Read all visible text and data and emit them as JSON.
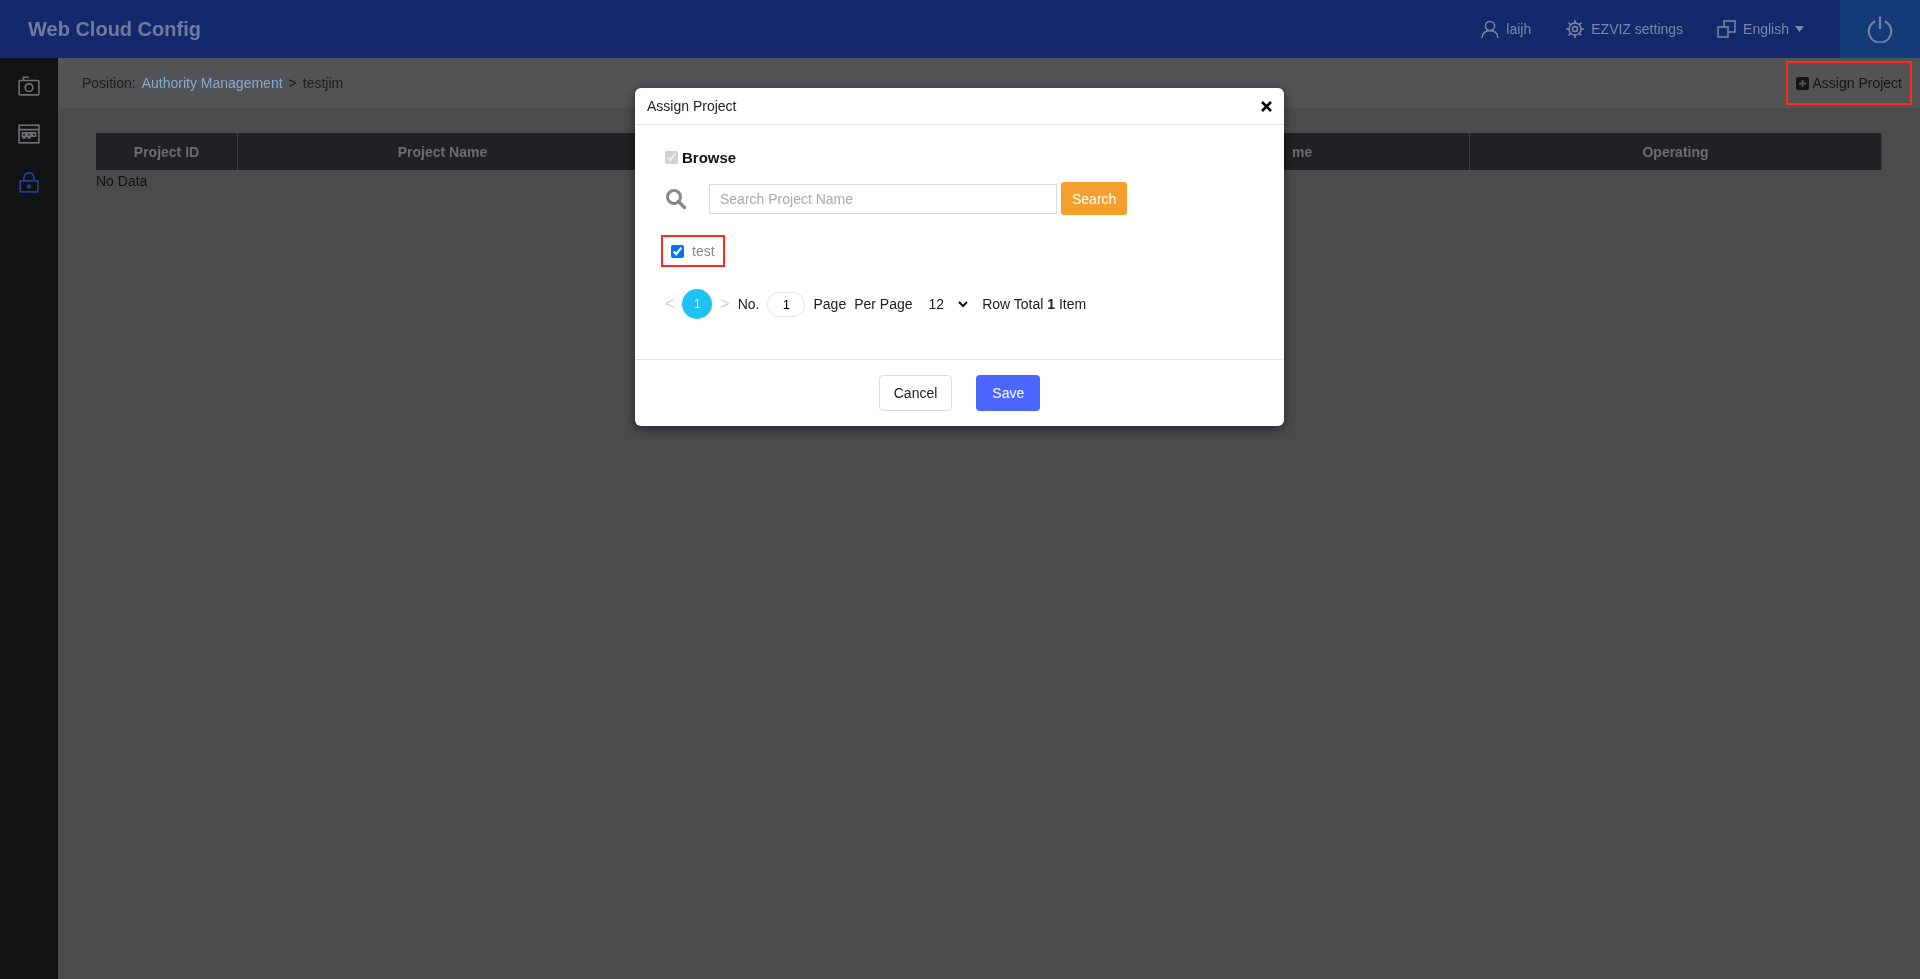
{
  "header": {
    "title": "Web Cloud Config",
    "user": "laijh",
    "settings": "EZVIZ settings",
    "language": "English"
  },
  "sidebar": {
    "items": [
      {
        "kind": "camera",
        "selected": false
      },
      {
        "kind": "calendar",
        "selected": false
      },
      {
        "kind": "lock",
        "selected": true
      }
    ]
  },
  "breadcrumb": {
    "prefix": "Position:",
    "link": "Authority Management",
    "separator": ">",
    "current": "testjim"
  },
  "assign_button": {
    "label": "Assign Project",
    "highlighted": true
  },
  "table": {
    "columns": [
      "Project ID",
      "Project Name",
      "me",
      "Operating"
    ],
    "empty_text": "No Data"
  },
  "dialog": {
    "title": "Assign Project",
    "browse": {
      "label": "Browse",
      "checked": true,
      "disabled": true
    },
    "search": {
      "placeholder": "Search Project Name",
      "button": "Search"
    },
    "projects": [
      {
        "name": "test",
        "checked": true,
        "highlighted": true
      }
    ],
    "pagination": {
      "prev": "<",
      "pages": [
        {
          "label": "1",
          "selected": true
        }
      ],
      "next": ">",
      "no_label": "No.",
      "page_value": "1",
      "page_label": "Page",
      "per_page_label": "Per Page",
      "per_page": "12",
      "total_text": "Row Total **1** Item"
    },
    "buttons": [
      {
        "label": "Cancel",
        "kind": "default"
      },
      {
        "label": "Save",
        "kind": "primary"
      }
    ]
  }
}
